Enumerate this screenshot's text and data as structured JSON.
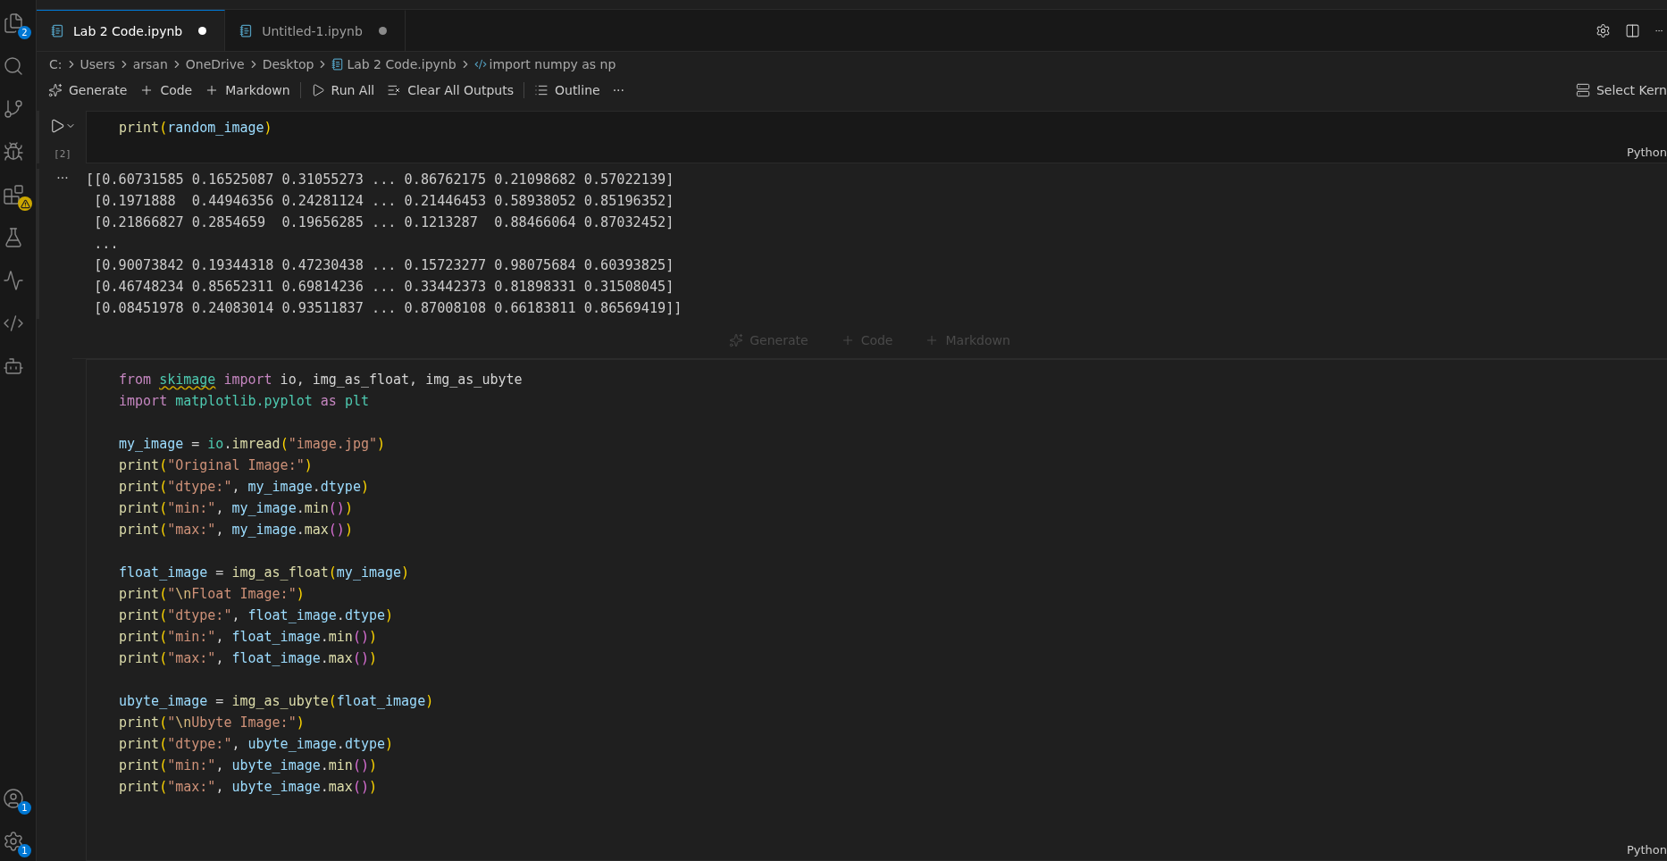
{
  "activity_bar": {
    "top": [
      {
        "kind": "files",
        "badge": "2"
      },
      {
        "kind": "search"
      },
      {
        "kind": "branch"
      },
      {
        "kind": "debug"
      },
      {
        "kind": "extensions",
        "warning": true
      },
      {
        "kind": "flask"
      },
      {
        "kind": "wave"
      },
      {
        "kind": "python"
      },
      {
        "kind": "bot"
      }
    ],
    "bottom": [
      {
        "kind": "account",
        "badge": "1"
      },
      {
        "kind": "settings",
        "badge": "1"
      }
    ]
  },
  "tabs": [
    {
      "label": "Lab 2 Code.ipynb",
      "selected": true,
      "dirty": true
    },
    {
      "label": "Untitled-1.ipynb",
      "selected": false,
      "dirty": true
    }
  ],
  "breadcrumb": [
    {
      "kind": "text",
      "label": "C:"
    },
    {
      "kind": "text",
      "label": "Users"
    },
    {
      "kind": "text",
      "label": "arsan"
    },
    {
      "kind": "text",
      "label": "OneDrive"
    },
    {
      "kind": "text",
      "label": "Desktop"
    },
    {
      "kind": "notebook",
      "label": "Lab 2 Code.ipynb"
    },
    {
      "kind": "python",
      "label": "import numpy as np"
    }
  ],
  "toolbar": [
    {
      "kind": "sparkle",
      "label": "Generate"
    },
    {
      "kind": "plus",
      "label": "Code"
    },
    {
      "kind": "plus",
      "label": "Markdown"
    },
    {
      "kind": "run",
      "label": "Run All"
    },
    {
      "kind": "clear",
      "label": "Clear All Outputs"
    },
    {
      "kind": "list",
      "label": "Outline"
    },
    {
      "kind": "more",
      "label": "···"
    }
  ],
  "kernel": "Select Kern",
  "cells": [
    {
      "count": "[2]",
      "language": "Python",
      "output_menu": "···",
      "lines": [
        {
          "kind": "code",
          "tokens": [
            {
              "kind": "f",
              "text": "print"
            },
            {
              "kind": "p",
              "text": "("
            },
            {
              "kind": "v",
              "text": "random_image"
            },
            {
              "kind": "p",
              "text": ")"
            }
          ]
        }
      ],
      "output": [
        "[[0.60731585 0.16525087 0.31055273 ... 0.86762175 0.21098682 0.57022139]",
        " [0.1971888  0.44946356 0.24281124 ... 0.21446453 0.58938052 0.85196352]",
        " [0.21866827 0.2854659  0.19656285 ... 0.1213287  0.88466064 0.87032452]",
        " ...",
        " [0.90073842 0.19344318 0.47230438 ... 0.15723277 0.98075684 0.60393825]",
        " [0.46748234 0.85652311 0.69814236 ... 0.33442373 0.81898331 0.31508045]",
        " [0.08451978 0.24083014 0.93511837 ... 0.87008108 0.66183811 0.86569419]]"
      ]
    },
    {
      "language": "Python",
      "lines": [
        {
          "kind": "code",
          "tokens": [
            {
              "kind": "k",
              "text": "from "
            },
            {
              "kind": "w",
              "text": "skimage"
            },
            {
              "kind": "k",
              "text": " import"
            },
            {
              "kind": "t",
              "text": " io, img_as_float, img_as_ubyte"
            }
          ]
        },
        {
          "kind": "code",
          "tokens": [
            {
              "kind": "k",
              "text": "import "
            },
            {
              "kind": "c",
              "text": "matplotlib.pyplot"
            },
            {
              "kind": "k",
              "text": " as "
            },
            {
              "kind": "c",
              "text": "plt"
            }
          ]
        },
        {
          "kind": "blank"
        },
        {
          "kind": "code",
          "tokens": [
            {
              "kind": "v",
              "text": "my_image"
            },
            {
              "kind": "t",
              "text": " = "
            },
            {
              "kind": "c",
              "text": "io"
            },
            {
              "kind": "t",
              "text": "."
            },
            {
              "kind": "f",
              "text": "imread"
            },
            {
              "kind": "p",
              "text": "("
            },
            {
              "kind": "s",
              "text": "\"image.jpg\""
            },
            {
              "kind": "p",
              "text": ")"
            }
          ]
        },
        {
          "kind": "code",
          "tokens": [
            {
              "kind": "f",
              "text": "print"
            },
            {
              "kind": "p",
              "text": "("
            },
            {
              "kind": "s",
              "text": "\"Original Image:\""
            },
            {
              "kind": "p",
              "text": ")"
            }
          ]
        },
        {
          "kind": "code",
          "tokens": [
            {
              "kind": "f",
              "text": "print"
            },
            {
              "kind": "p",
              "text": "("
            },
            {
              "kind": "s",
              "text": "\"dtype:\""
            },
            {
              "kind": "t",
              "text": ", "
            },
            {
              "kind": "v",
              "text": "my_image"
            },
            {
              "kind": "t",
              "text": "."
            },
            {
              "kind": "v",
              "text": "dtype"
            },
            {
              "kind": "p",
              "text": ")"
            }
          ]
        },
        {
          "kind": "code",
          "tokens": [
            {
              "kind": "f",
              "text": "print"
            },
            {
              "kind": "p",
              "text": "("
            },
            {
              "kind": "s",
              "text": "\"min:\""
            },
            {
              "kind": "t",
              "text": ", "
            },
            {
              "kind": "v",
              "text": "my_image"
            },
            {
              "kind": "t",
              "text": "."
            },
            {
              "kind": "f",
              "text": "min"
            },
            {
              "kind": "q",
              "text": "()"
            },
            {
              "kind": "p",
              "text": ")"
            }
          ]
        },
        {
          "kind": "code",
          "tokens": [
            {
              "kind": "f",
              "text": "print"
            },
            {
              "kind": "p",
              "text": "("
            },
            {
              "kind": "s",
              "text": "\"max:\""
            },
            {
              "kind": "t",
              "text": ", "
            },
            {
              "kind": "v",
              "text": "my_image"
            },
            {
              "kind": "t",
              "text": "."
            },
            {
              "kind": "f",
              "text": "max"
            },
            {
              "kind": "q",
              "text": "()"
            },
            {
              "kind": "p",
              "text": ")"
            }
          ]
        },
        {
          "kind": "blank"
        },
        {
          "kind": "code",
          "tokens": [
            {
              "kind": "v",
              "text": "float_image"
            },
            {
              "kind": "t",
              "text": " = "
            },
            {
              "kind": "f",
              "text": "img_as_float"
            },
            {
              "kind": "p",
              "text": "("
            },
            {
              "kind": "v",
              "text": "my_image"
            },
            {
              "kind": "p",
              "text": ")"
            }
          ]
        },
        {
          "kind": "code",
          "tokens": [
            {
              "kind": "f",
              "text": "print"
            },
            {
              "kind": "p",
              "text": "("
            },
            {
              "kind": "s",
              "text": "\""
            },
            {
              "kind": "e",
              "text": "\\n"
            },
            {
              "kind": "s",
              "text": "Float Image:\""
            },
            {
              "kind": "p",
              "text": ")"
            }
          ]
        },
        {
          "kind": "code",
          "tokens": [
            {
              "kind": "f",
              "text": "print"
            },
            {
              "kind": "p",
              "text": "("
            },
            {
              "kind": "s",
              "text": "\"dtype:\""
            },
            {
              "kind": "t",
              "text": ", "
            },
            {
              "kind": "v",
              "text": "float_image"
            },
            {
              "kind": "t",
              "text": "."
            },
            {
              "kind": "v",
              "text": "dtype"
            },
            {
              "kind": "p",
              "text": ")"
            }
          ]
        },
        {
          "kind": "code",
          "tokens": [
            {
              "kind": "f",
              "text": "print"
            },
            {
              "kind": "p",
              "text": "("
            },
            {
              "kind": "s",
              "text": "\"min:\""
            },
            {
              "kind": "t",
              "text": ", "
            },
            {
              "kind": "v",
              "text": "float_image"
            },
            {
              "kind": "t",
              "text": "."
            },
            {
              "kind": "f",
              "text": "min"
            },
            {
              "kind": "q",
              "text": "()"
            },
            {
              "kind": "p",
              "text": ")"
            }
          ]
        },
        {
          "kind": "code",
          "tokens": [
            {
              "kind": "f",
              "text": "print"
            },
            {
              "kind": "p",
              "text": "("
            },
            {
              "kind": "s",
              "text": "\"max:\""
            },
            {
              "kind": "t",
              "text": ", "
            },
            {
              "kind": "v",
              "text": "float_image"
            },
            {
              "kind": "t",
              "text": "."
            },
            {
              "kind": "f",
              "text": "max"
            },
            {
              "kind": "q",
              "text": "()"
            },
            {
              "kind": "p",
              "text": ")"
            }
          ]
        },
        {
          "kind": "blank"
        },
        {
          "kind": "code",
          "tokens": [
            {
              "kind": "v",
              "text": "ubyte_image"
            },
            {
              "kind": "t",
              "text": " = "
            },
            {
              "kind": "f",
              "text": "img_as_ubyte"
            },
            {
              "kind": "p",
              "text": "("
            },
            {
              "kind": "v",
              "text": "float_image"
            },
            {
              "kind": "p",
              "text": ")"
            }
          ]
        },
        {
          "kind": "code",
          "tokens": [
            {
              "kind": "f",
              "text": "print"
            },
            {
              "kind": "p",
              "text": "("
            },
            {
              "kind": "s",
              "text": "\""
            },
            {
              "kind": "e",
              "text": "\\n"
            },
            {
              "kind": "s",
              "text": "Ubyte Image:\""
            },
            {
              "kind": "p",
              "text": ")"
            }
          ]
        },
        {
          "kind": "code",
          "tokens": [
            {
              "kind": "f",
              "text": "print"
            },
            {
              "kind": "p",
              "text": "("
            },
            {
              "kind": "s",
              "text": "\"dtype:\""
            },
            {
              "kind": "t",
              "text": ", "
            },
            {
              "kind": "v",
              "text": "ubyte_image"
            },
            {
              "kind": "t",
              "text": "."
            },
            {
              "kind": "v",
              "text": "dtype"
            },
            {
              "kind": "p",
              "text": ")"
            }
          ]
        },
        {
          "kind": "code",
          "tokens": [
            {
              "kind": "f",
              "text": "print"
            },
            {
              "kind": "p",
              "text": "("
            },
            {
              "kind": "s",
              "text": "\"min:\""
            },
            {
              "kind": "t",
              "text": ", "
            },
            {
              "kind": "v",
              "text": "ubyte_image"
            },
            {
              "kind": "t",
              "text": "."
            },
            {
              "kind": "f",
              "text": "min"
            },
            {
              "kind": "q",
              "text": "()"
            },
            {
              "kind": "p",
              "text": ")"
            }
          ]
        },
        {
          "kind": "code",
          "tokens": [
            {
              "kind": "f",
              "text": "print"
            },
            {
              "kind": "p",
              "text": "("
            },
            {
              "kind": "s",
              "text": "\"max:\""
            },
            {
              "kind": "t",
              "text": ", "
            },
            {
              "kind": "v",
              "text": "ubyte_image"
            },
            {
              "kind": "t",
              "text": "."
            },
            {
              "kind": "f",
              "text": "max"
            },
            {
              "kind": "q",
              "text": "()"
            },
            {
              "kind": "p",
              "text": ")"
            }
          ]
        }
      ]
    }
  ],
  "insert_bar": [
    {
      "kind": "sparkle",
      "label": "Generate"
    },
    {
      "kind": "plus",
      "label": "Code"
    },
    {
      "kind": "plus",
      "label": "Markdown"
    }
  ]
}
